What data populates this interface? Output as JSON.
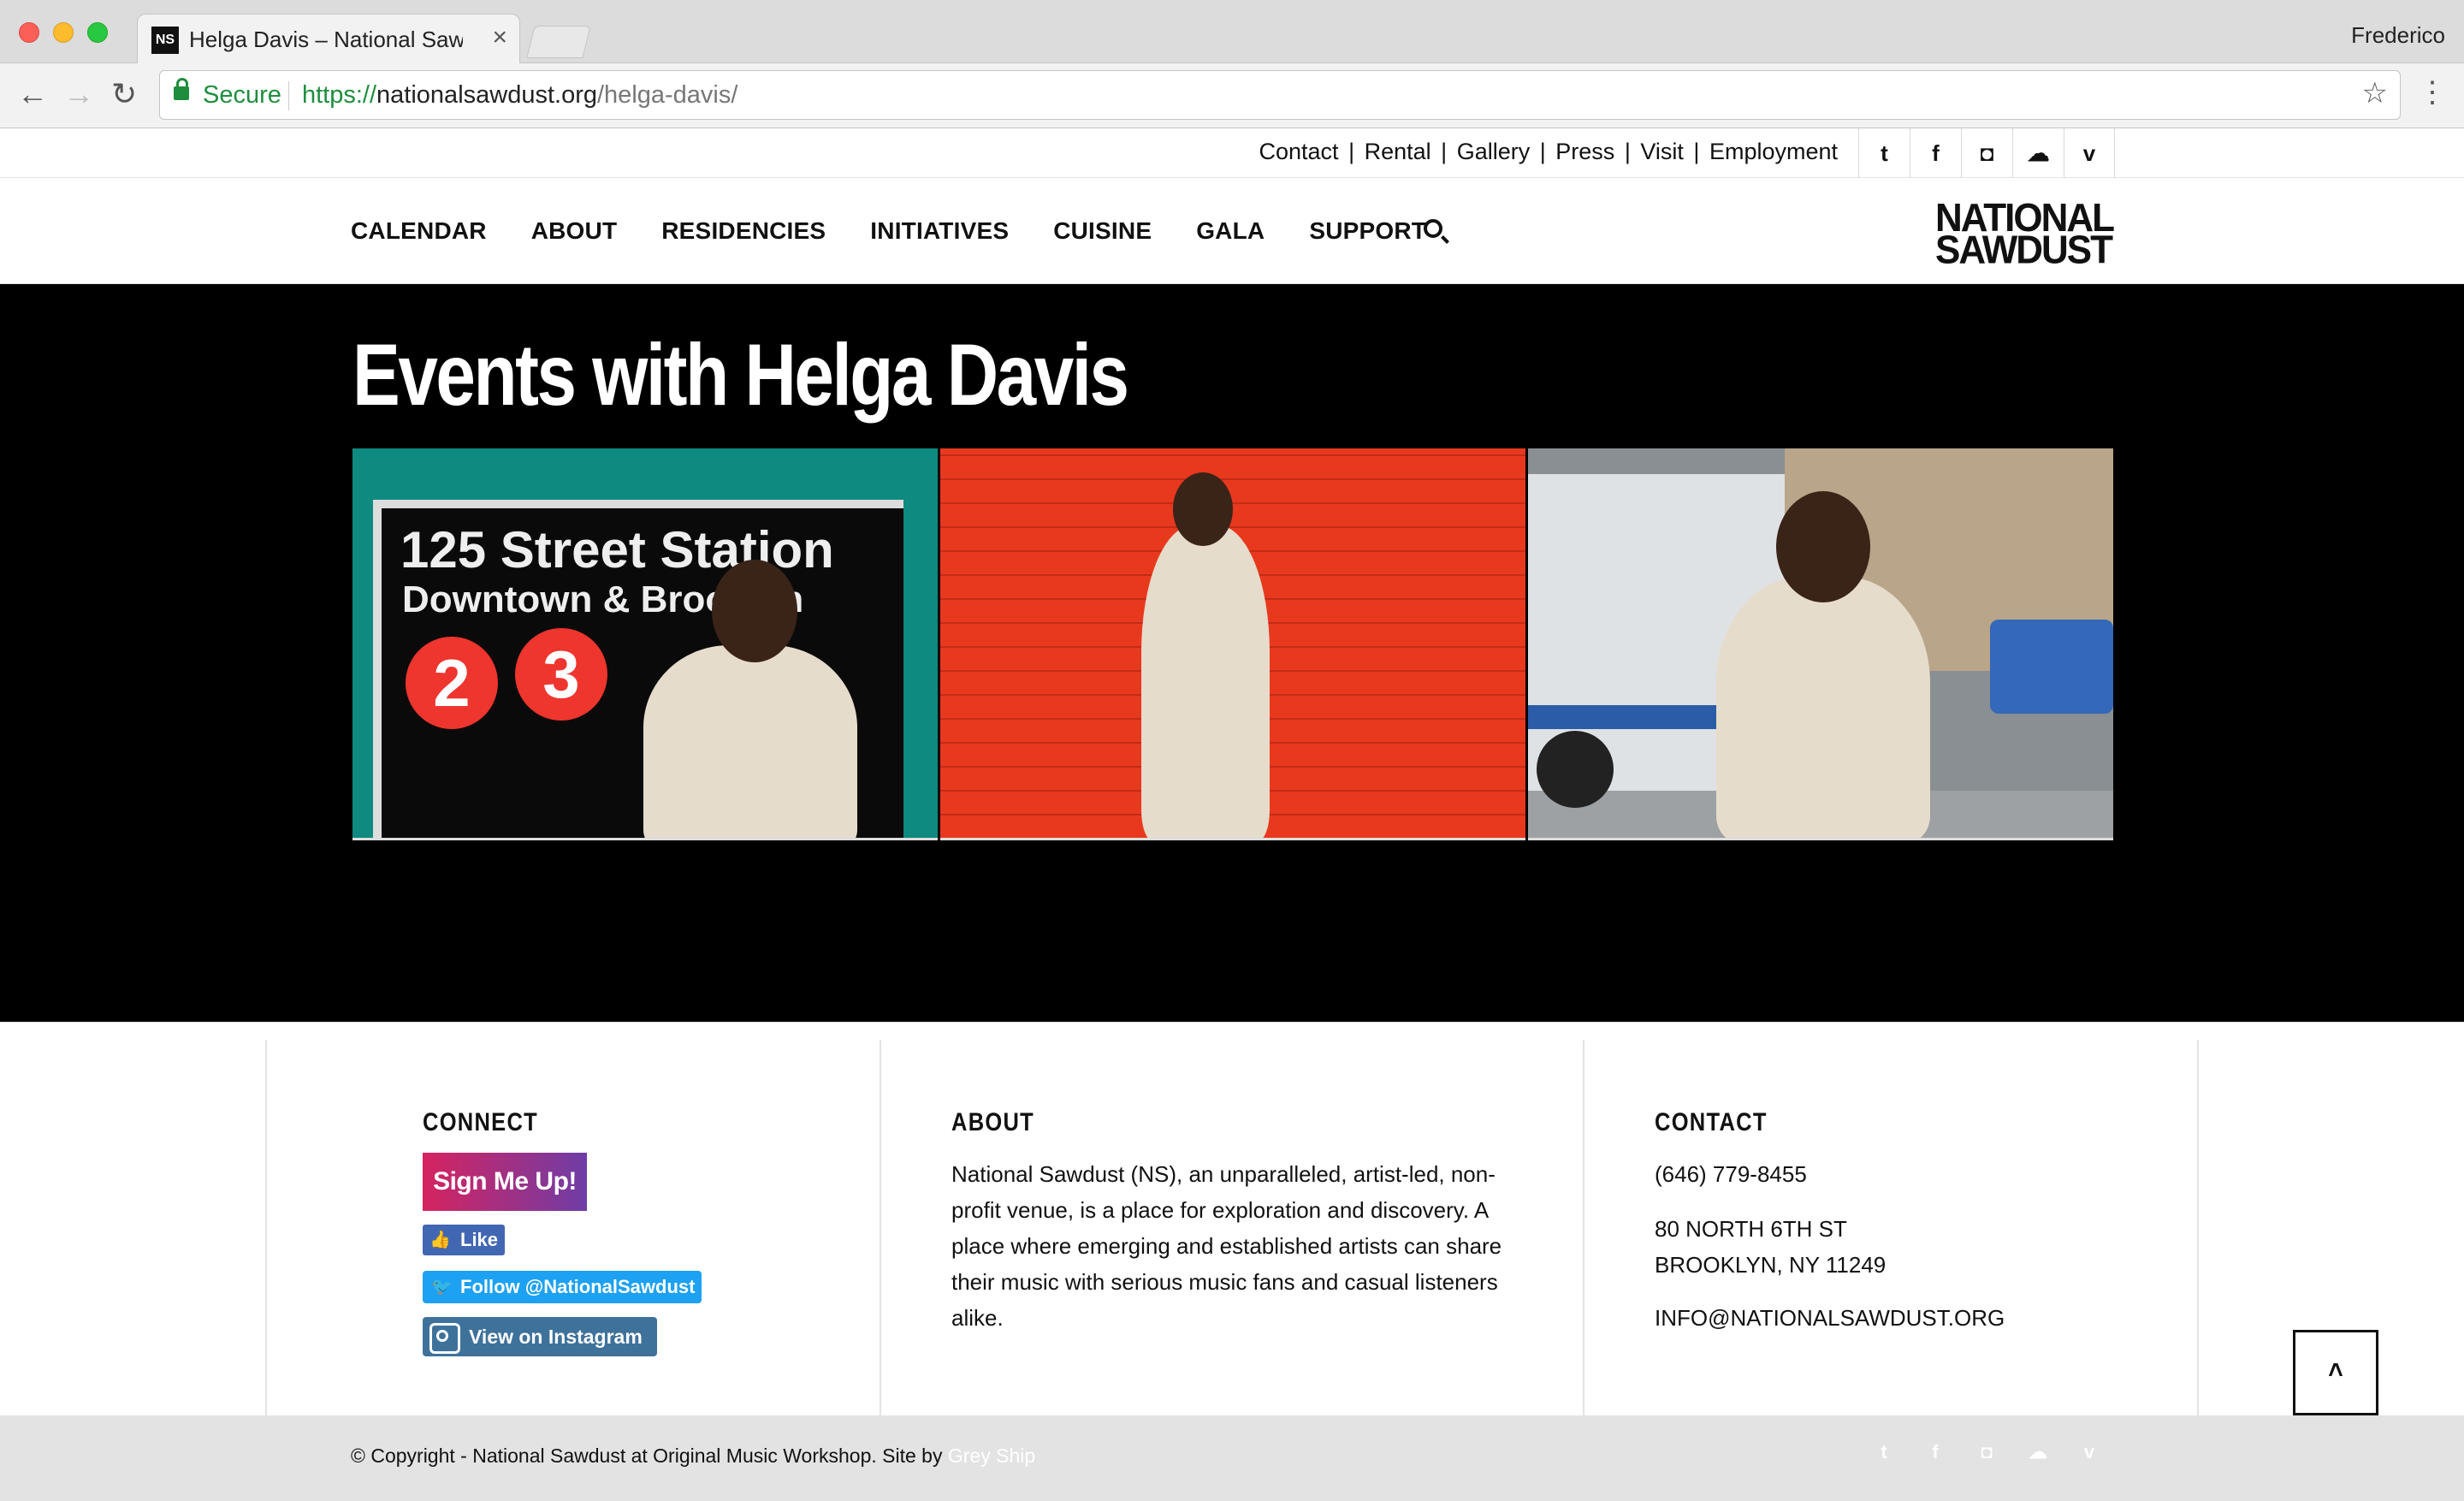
{
  "browser": {
    "tab_title": "Helga Davis – National Sawdust",
    "tab_favicon": "NS",
    "tab_close": "×",
    "profile": "Frederico",
    "secure_label": "Secure",
    "url_proto": "https://",
    "url_host": "nationalsawdust.org",
    "url_path": "/helga-davis/",
    "back_icon": "←",
    "forward_icon": "→",
    "reload_icon": "↻",
    "star_icon": "☆",
    "menu_icon": "⋮"
  },
  "toplinks": {
    "items": [
      "Contact",
      "Rental",
      "Gallery",
      "Press",
      "Visit",
      "Employment"
    ],
    "separator": "|"
  },
  "social": {
    "twitter": "t",
    "facebook": "f",
    "instagram": "◘",
    "soundcloud": "☁",
    "vimeo": "v"
  },
  "nav": {
    "items": [
      "CALENDAR",
      "ABOUT",
      "RESIDENCIES",
      "INITIATIVES",
      "CUISINE",
      "GALA",
      "SUPPORT"
    ]
  },
  "logo": {
    "line1": "NATIONAL",
    "line2": "SAWDUST"
  },
  "hero": {
    "title": "Events with Helga Davis",
    "photo1_sign_line1": "125 Street Station",
    "photo1_sign_line2": "Downtown & Brooklyn",
    "photo1_bullet1": "2",
    "photo1_bullet2": "3"
  },
  "footer": {
    "connect": {
      "heading": "CONNECT",
      "signup": "Sign Me Up!",
      "like": "Like",
      "follow": "Follow @NationalSawdust",
      "instagram": "View on Instagram"
    },
    "about": {
      "heading": "ABOUT",
      "text": "National Sawdust (NS), an unparalleled, artist-led, non-profit venue, is a place for exploration and discovery. A place where emerging and established artists can share their music with serious music fans and casual listeners alike."
    },
    "contact": {
      "heading": "CONTACT",
      "phone": "(646) 779-8455",
      "address1": "80 NORTH 6TH ST",
      "address2": "BROOKLYN, NY 11249",
      "email": "INFO@NATIONALSAWDUST.ORG"
    },
    "scroll_top": "˄"
  },
  "bottombar": {
    "copyright": "© Copyright - National Sawdust at Original Music Workshop. Site by",
    "credit": "Grey Ship"
  }
}
